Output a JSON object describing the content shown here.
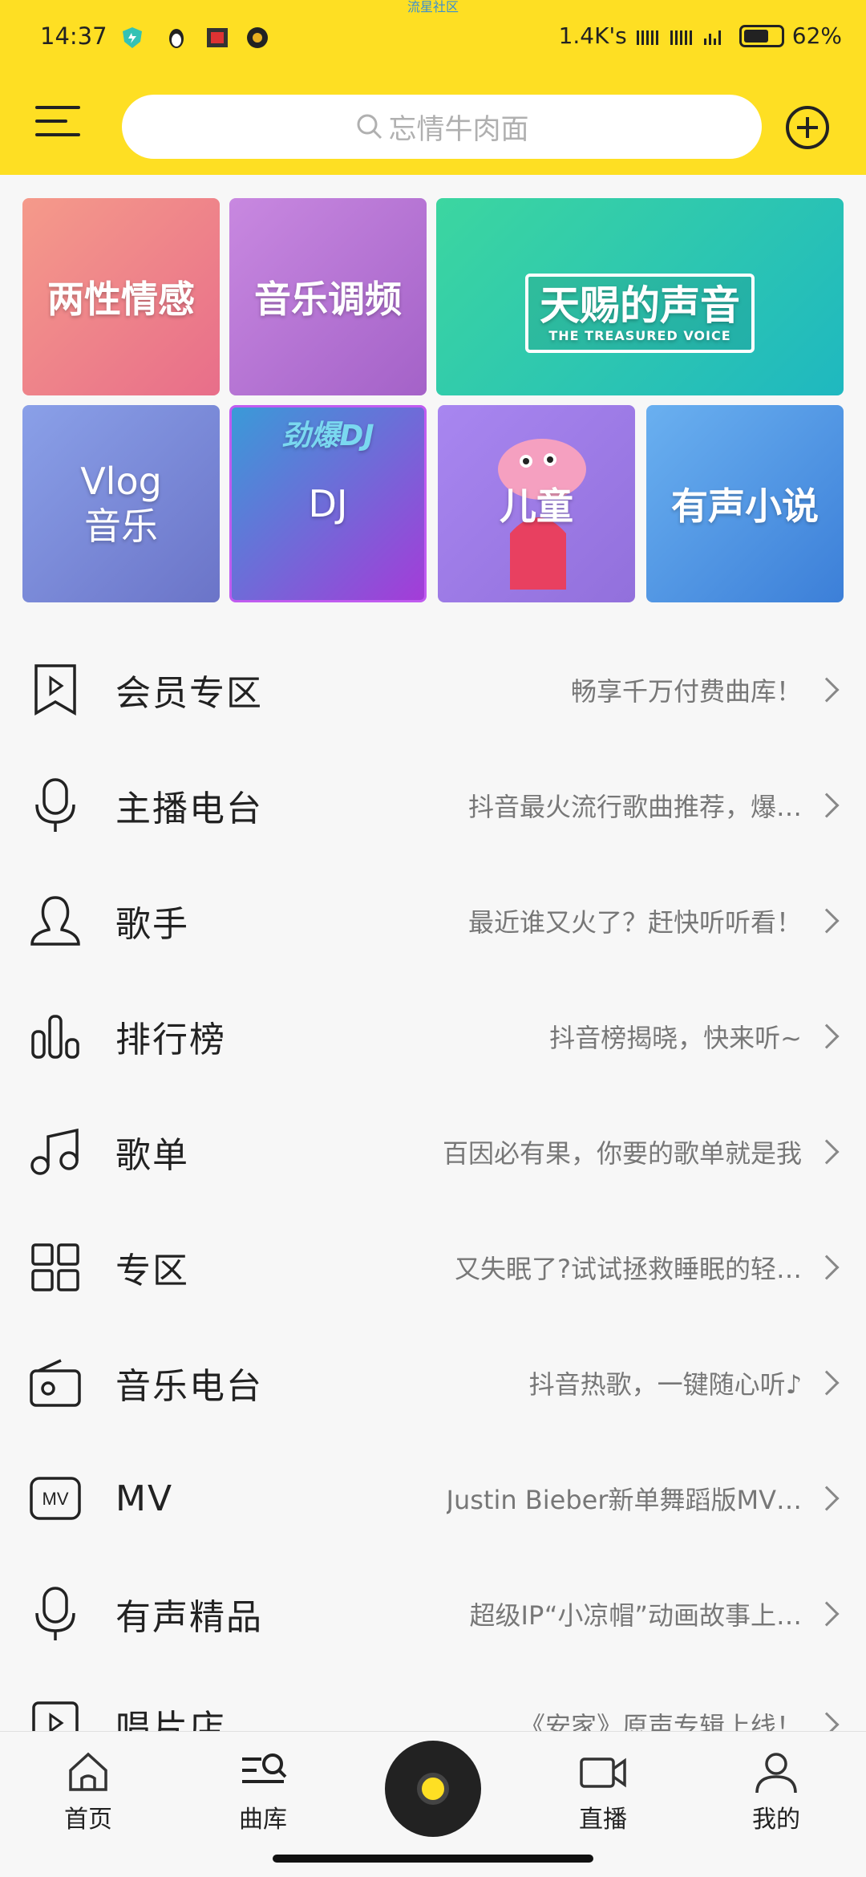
{
  "status_bar": {
    "time": "14:37",
    "network_speed": "1.4K's",
    "battery": "62%",
    "watermark": "流星社区"
  },
  "header": {
    "search_placeholder": "忘情牛肉面",
    "icons": {
      "menu": "menu-icon",
      "search": "search-icon",
      "add": "plus-circle-icon"
    },
    "accent": "#fedf23"
  },
  "cards": [
    {
      "label": "两性情感",
      "color": "#f08a8a"
    },
    {
      "label": "音乐调频",
      "color": "#c07ad8"
    },
    {
      "label": "天赐的声音",
      "sub": "THE TREASURED VOICE",
      "color": "#22c896"
    },
    {
      "label": "Vlog\n音乐",
      "color": "#7a8de0"
    },
    {
      "label": "DJ",
      "banner": "劲爆DJ",
      "color": "#8a4ed8"
    },
    {
      "label": "儿童",
      "color": "#a07de8"
    },
    {
      "label": "有声小说",
      "color": "#4c9be8"
    }
  ],
  "list": [
    {
      "title": "会员专区",
      "desc": "畅享千万付费曲库！",
      "icon": "bookmark-play-icon"
    },
    {
      "title": "主播电台",
      "desc": "抖音最火流行歌曲推荐，爆…",
      "icon": "microphone-icon"
    },
    {
      "title": "歌手",
      "desc": "最近谁又火了？赶快听听看！",
      "icon": "person-icon"
    },
    {
      "title": "排行榜",
      "desc": "抖音榜揭晓，快来听~",
      "icon": "bar-chart-icon"
    },
    {
      "title": "歌单",
      "desc": "百因必有果，你要的歌单就是我",
      "icon": "music-note-icon"
    },
    {
      "title": "专区",
      "desc": "又失眠了?试试拯救睡眠的轻…",
      "icon": "grid-icon"
    },
    {
      "title": "音乐电台",
      "desc": "抖音热歌，一键随心听♪",
      "icon": "radio-icon"
    },
    {
      "title": "MV",
      "desc": "Justin Bieber新单舞蹈版MV…",
      "icon": "mv-icon"
    },
    {
      "title": "有声精品",
      "desc": "超级IP“小凉帽”动画故事上…",
      "icon": "microphone-icon"
    },
    {
      "title": "唱片店",
      "desc": "《安家》原声专辑上线！",
      "icon": "play-box-icon"
    }
  ],
  "bottom_nav": [
    {
      "label": "首页",
      "icon": "home-icon"
    },
    {
      "label": "曲库",
      "icon": "library-search-icon",
      "active": true
    },
    {
      "label": "",
      "icon": "vinyl-disc-icon"
    },
    {
      "label": "直播",
      "icon": "video-camera-icon"
    },
    {
      "label": "我的",
      "icon": "user-icon"
    }
  ]
}
